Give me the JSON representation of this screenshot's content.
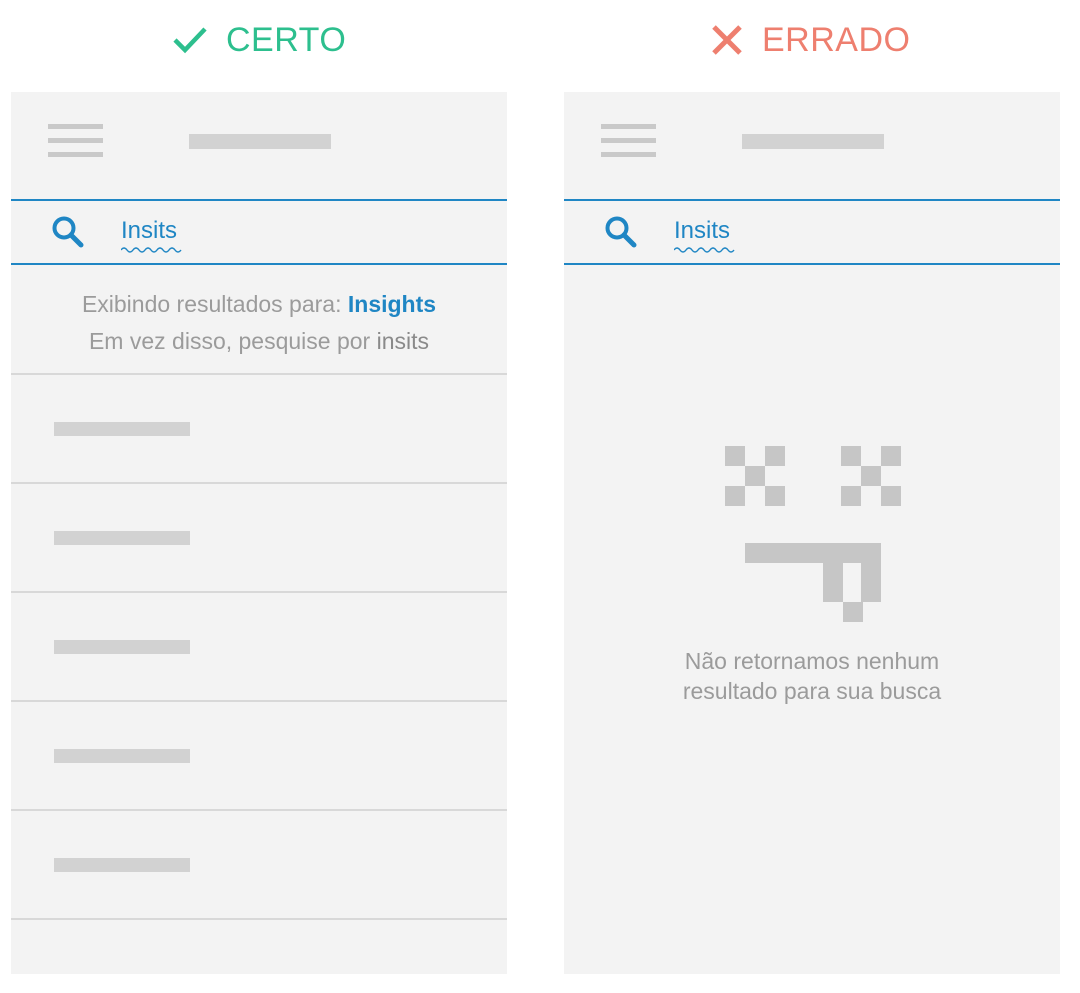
{
  "labels": {
    "correct": "CERTO",
    "wrong": "ERRADO"
  },
  "colors": {
    "correct": "#2dbf8e",
    "wrong": "#ee7f6f",
    "accent": "#1f86c4",
    "placeholder": "#d2d2d2",
    "screen_bg": "#f3f3f3"
  },
  "left_phone": {
    "search_query": "Insits",
    "suggestion": {
      "showing_prefix": "Exibindo resultados para: ",
      "corrected_term": "Insights",
      "instead_prefix": "Em vez disso, pesquise por ",
      "original_term": "insits"
    },
    "result_count_placeholders": 5
  },
  "right_phone": {
    "search_query": "Insits",
    "empty_message_line1": "Não retornamos nenhum",
    "empty_message_line2": "resultado para sua busca"
  },
  "icons": [
    "check-icon",
    "cross-icon",
    "menu-icon",
    "search-icon",
    "sad-face-icon"
  ]
}
